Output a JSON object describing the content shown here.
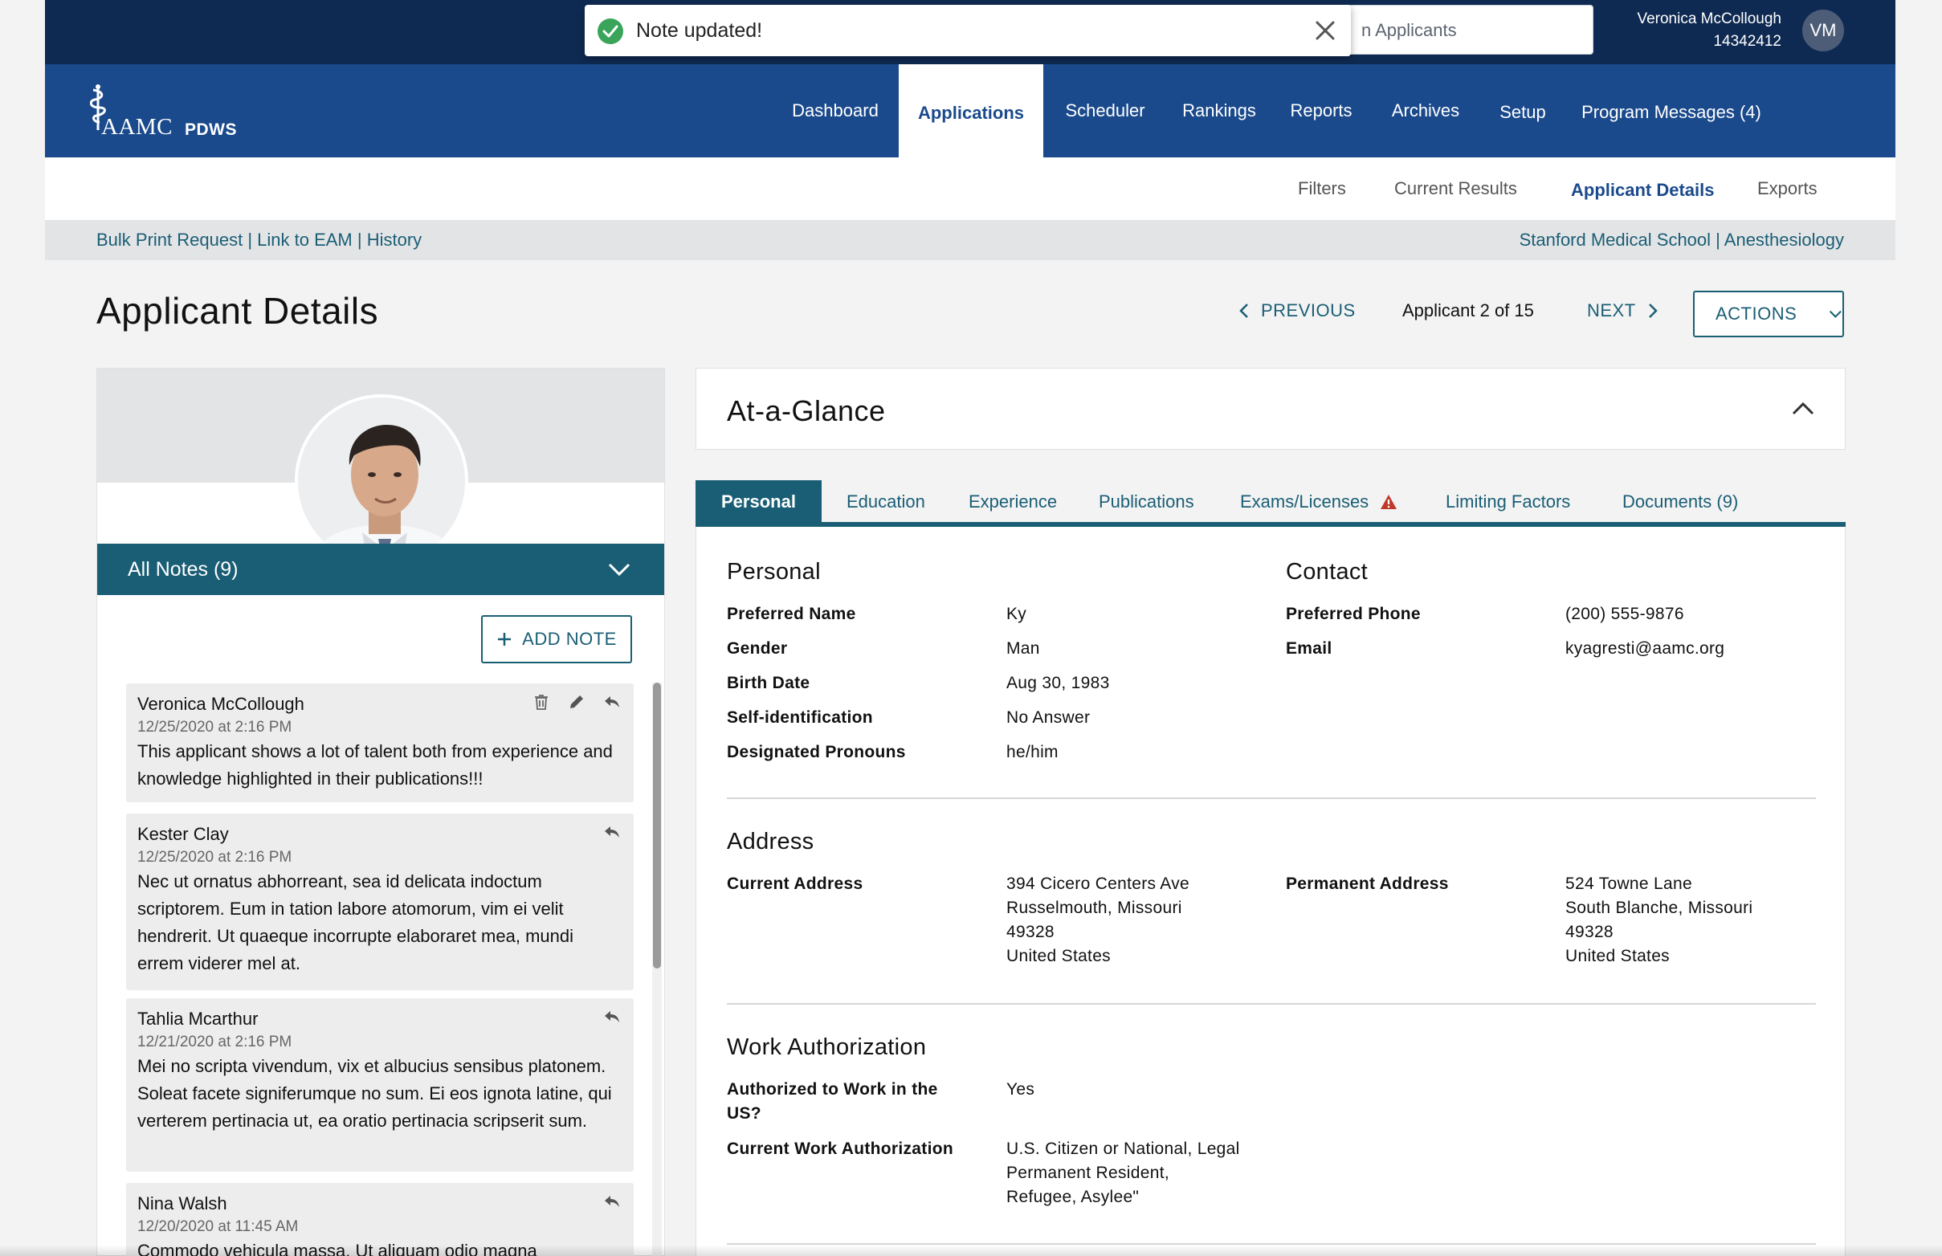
{
  "topbar": {
    "search_text": "n Applicants",
    "user_name": "Veronica McCollough",
    "user_id": "14342412",
    "user_initials": "VM"
  },
  "toast": {
    "message": "Note updated!"
  },
  "brand": {
    "logo_text": "AAMC",
    "app_name": "PDWS"
  },
  "nav": [
    {
      "label": "Dashboard"
    },
    {
      "label": "Applications",
      "active": true
    },
    {
      "label": "Scheduler"
    },
    {
      "label": "Rankings"
    },
    {
      "label": "Reports"
    },
    {
      "label": "Archives"
    },
    {
      "label": "Setup"
    },
    {
      "label": "Program Messages (4)"
    }
  ],
  "subnav": [
    {
      "label": "Filters"
    },
    {
      "label": "Current Results"
    },
    {
      "label": "Applicant Details",
      "active": true
    },
    {
      "label": "Exports"
    }
  ],
  "crumbs": {
    "links": [
      "Bulk Print Request",
      "Link to EAM",
      "History"
    ],
    "program": [
      "Stanford Medical School",
      "Anesthesiology"
    ],
    "separator": " | "
  },
  "header": {
    "title": "Applicant Details",
    "previous": "PREVIOUS",
    "count": "Applicant 2 of 15",
    "next": "NEXT",
    "actions": "ACTIONS"
  },
  "notes": {
    "header": "All Notes (9)",
    "add_label": "ADD NOTE",
    "items": [
      {
        "author": "Veronica McCollough",
        "date": "12/25/2020 at 2:16 PM",
        "body": "This applicant shows a lot of talent both from experience and knowledge highlighted in their publications!!!",
        "editable": true
      },
      {
        "author": "Kester Clay",
        "date": "12/25/2020 at 2:16 PM",
        "body": "Nec ut ornatus abhorreant, sea id delicata indoctum scriptorem. Eum in tation labore atomorum, vim ei velit hendrerit. Ut quaeque incorrupte elaboraret mea, mundi errem viderer mel at."
      },
      {
        "author": "Tahlia Mcarthur",
        "date": "12/21/2020 at 2:16 PM",
        "body": "Mei no scripta vivendum, vix et albucius sensibus platonem. Soleat facete signiferumque no sum. Ei eos ignota latine, qui verterem pertinacia ut, ea oratio pertinacia scripserit sum."
      },
      {
        "author": "Nina Walsh",
        "date": "12/20/2020 at 11:45 AM",
        "body": "Commodo vehicula massa. Ut aliquam odio magna"
      }
    ]
  },
  "glance": {
    "title": "At-a-Glance"
  },
  "tabs": [
    {
      "label": "Personal",
      "active": true
    },
    {
      "label": "Education"
    },
    {
      "label": "Experience"
    },
    {
      "label": "Publications"
    },
    {
      "label": "Exams/Licenses",
      "warning": true
    },
    {
      "label": "Limiting Factors"
    },
    {
      "label": "Documents (9)"
    }
  ],
  "personal": {
    "title": "Personal",
    "fields": [
      {
        "label": "Preferred Name",
        "value": "Ky"
      },
      {
        "label": "Gender",
        "value": "Man"
      },
      {
        "label": "Birth Date",
        "value": "Aug 30, 1983"
      },
      {
        "label": "Self-identification",
        "value": "No Answer"
      },
      {
        "label": "Designated Pronouns",
        "value": "he/him"
      }
    ]
  },
  "contact": {
    "title": "Contact",
    "fields": [
      {
        "label": "Preferred Phone",
        "value": "(200) 555-9876"
      },
      {
        "label": "Email",
        "value": "kyagresti@aamc.org"
      }
    ]
  },
  "address": {
    "title": "Address",
    "current_label": "Current Address",
    "current": [
      "394 Cicero Centers Ave",
      "Russelmouth, Missouri",
      "49328",
      "United States"
    ],
    "permanent_label": "Permanent Address",
    "permanent": [
      "524 Towne Lane",
      "South Blanche, Missouri",
      "49328",
      "United States"
    ]
  },
  "work": {
    "title": "Work Authorization",
    "authorized_label": [
      "Authorized to Work in the",
      "US?"
    ],
    "authorized_value": "Yes",
    "current_label": "Current Work Authorization",
    "current_value": [
      "U.S. Citizen or National, Legal",
      "Permanent Resident,",
      "Refugee, Asylee\""
    ]
  },
  "colors": {
    "topbar": "#0f2a52",
    "navbar": "#1a4a8c",
    "teal": "#1a5e75",
    "success": "#3aa55a",
    "warning": "#c0392b"
  }
}
